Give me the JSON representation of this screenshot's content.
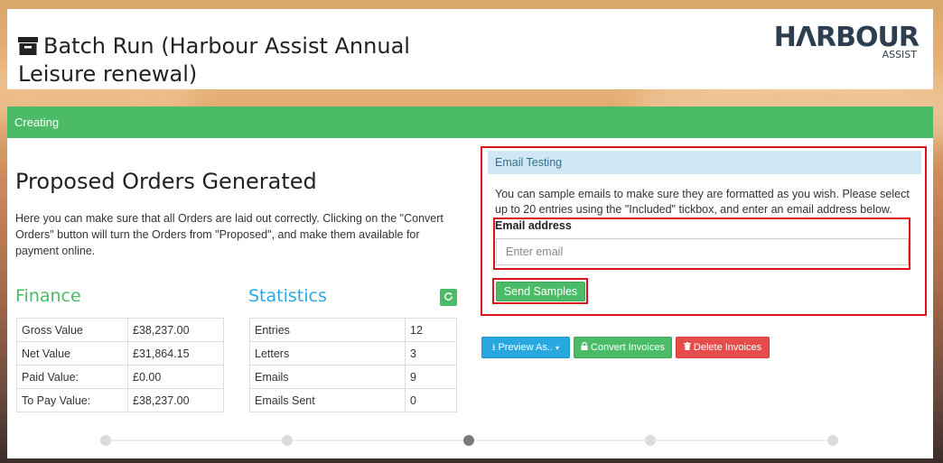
{
  "header": {
    "title": "Batch Run (Harbour Assist Annual Leisure renewal)",
    "logo_main": "HΛRBOUR",
    "logo_sub": "ASSIST",
    "title_icon": "archive-icon"
  },
  "status_bar": {
    "label": "Creating",
    "color": "#4cbb68"
  },
  "main": {
    "title": "Proposed Orders Generated",
    "description": "Here you can make sure that all Orders are laid out correctly. Clicking on the \"Convert Orders\" button will turn the Orders from \"Proposed\", and make them available for payment online."
  },
  "finance": {
    "heading": "Finance",
    "rows": [
      {
        "label": "Gross Value",
        "value": "£38,237.00"
      },
      {
        "label": "Net Value",
        "value": "£31,864.15"
      },
      {
        "label": "Paid Value:",
        "value": "£0.00"
      },
      {
        "label": "To Pay Value:",
        "value": "£38,237.00"
      }
    ]
  },
  "statistics": {
    "heading": "Statistics",
    "refresh_icon": "refresh-icon",
    "rows": [
      {
        "label": "Entries",
        "value": "12"
      },
      {
        "label": "Letters",
        "value": "3"
      },
      {
        "label": "Emails",
        "value": "9"
      },
      {
        "label": "Emails Sent",
        "value": "0"
      }
    ]
  },
  "email_testing": {
    "header": "Email Testing",
    "description": "You can sample emails to make sure they are formatted as you wish. Please select up to 20 entries using the \"Included\" tickbox, and enter an email address below.",
    "email_label": "Email address",
    "email_placeholder": "Enter email",
    "email_value": "",
    "send_label": "Send Samples"
  },
  "actions": {
    "preview_label": "Preview As..",
    "convert_label": "Convert Invoices",
    "delete_label": "Delete Invoices"
  },
  "colors": {
    "green": "#4cbb68",
    "blue": "#29a8e0",
    "red": "#e74c4c",
    "highlight": "#d9141a"
  },
  "progress": {
    "steps": 5,
    "active_step": 3
  }
}
